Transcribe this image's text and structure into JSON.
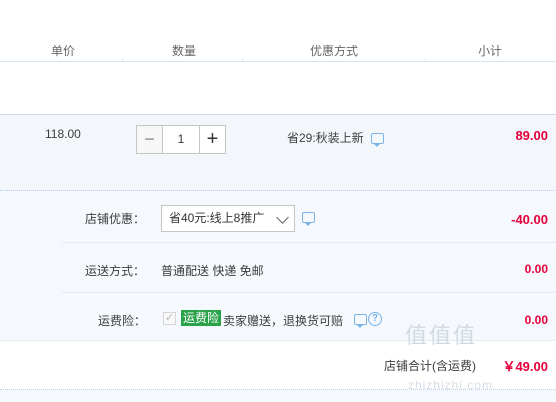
{
  "header": {
    "columns": [
      "单价",
      "数量",
      "优惠方式",
      "小计"
    ]
  },
  "item": {
    "unit_price": "118.00",
    "quantity": "1",
    "minus_label": "−",
    "plus_label": "+",
    "promotion": "省29:秋装上新",
    "subtotal": "89.00"
  },
  "shop": {
    "discount_label": "店铺优惠：",
    "discount_option": "省40元:线上8推广",
    "discount_value": "-40.00",
    "shipping_label": "运送方式：",
    "shipping_text": "普通配送 快递 免邮",
    "shipping_value": "0.00",
    "insurance_label": "运费险：",
    "insurance_badge": "运费险",
    "insurance_text": "卖家赠送，退换货可赔",
    "insurance_value": "0.00",
    "total_label": "店铺合计(含运费)",
    "total_value": "￥49.00"
  },
  "watermark": {
    "text": "值值值",
    "url": "zhizhizhi.com"
  },
  "colors": {
    "price_red": "#e4003a",
    "badge_green": "#2aa24a",
    "icon_blue": "#7db4e6"
  }
}
